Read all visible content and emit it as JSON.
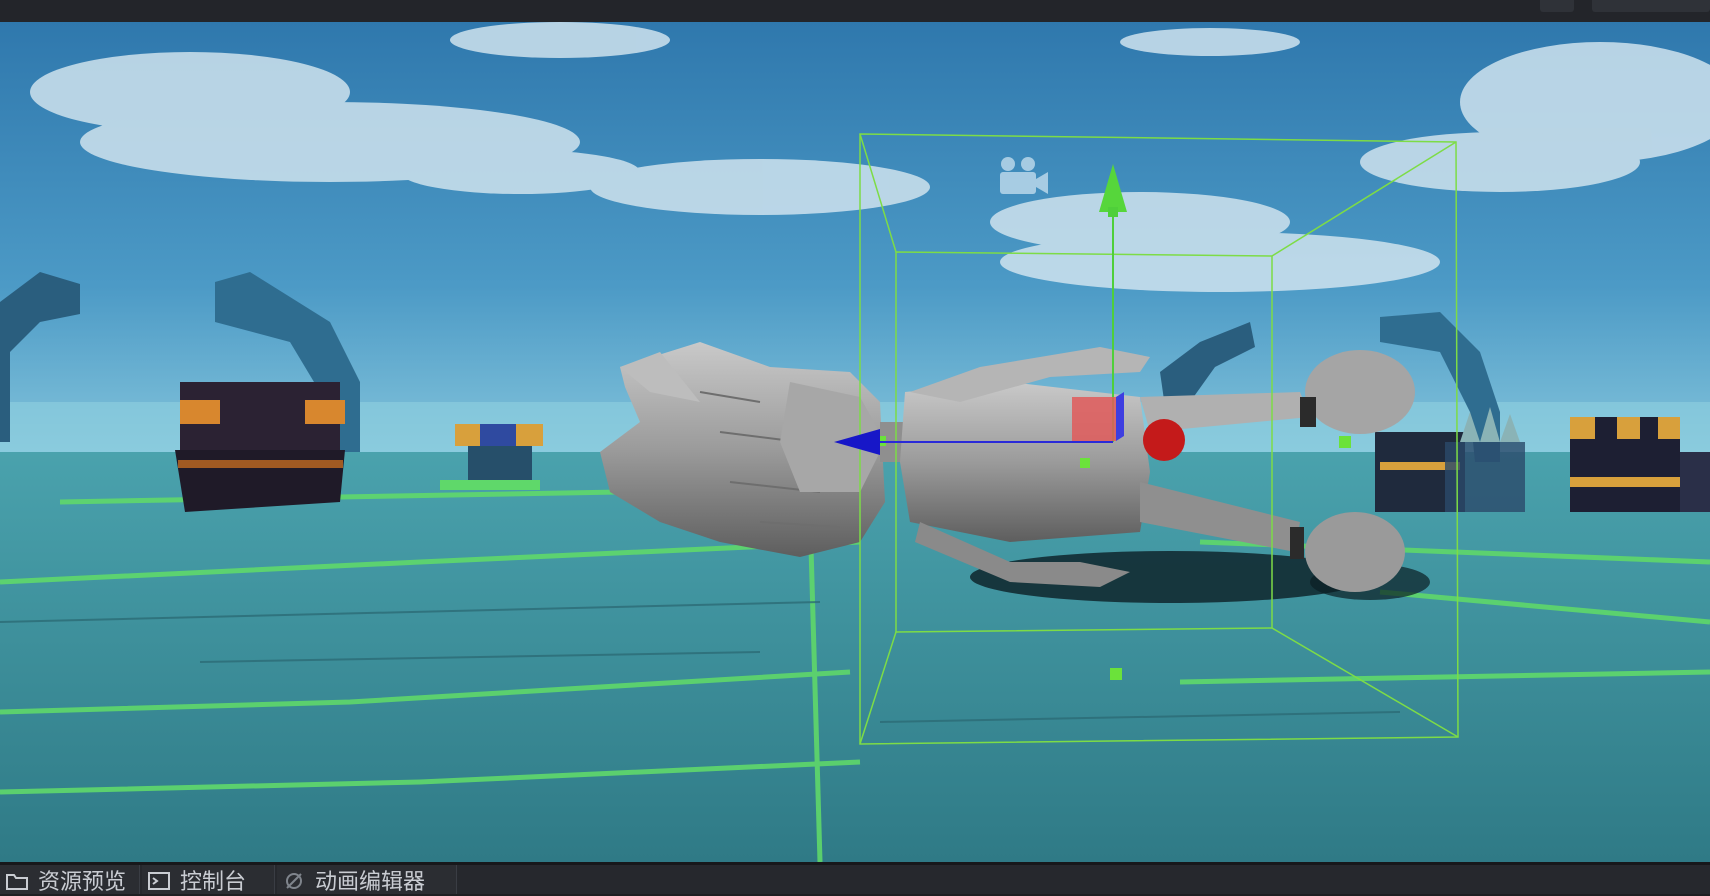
{
  "bottom_tabs": [
    {
      "label": "资源预览",
      "icon": "folder-icon"
    },
    {
      "label": "控制台",
      "icon": "terminal-icon"
    },
    {
      "label": "动画编辑器",
      "icon": "animation-icon"
    }
  ],
  "colors": {
    "sky": "#3f86b8",
    "ground": "#3c8c99",
    "selection_box": "#7ddc46",
    "axis_y": "#5fd23f",
    "axis_x": "#1c1cd2",
    "axis_z": "#e05050",
    "model": "#9a9a9a"
  }
}
